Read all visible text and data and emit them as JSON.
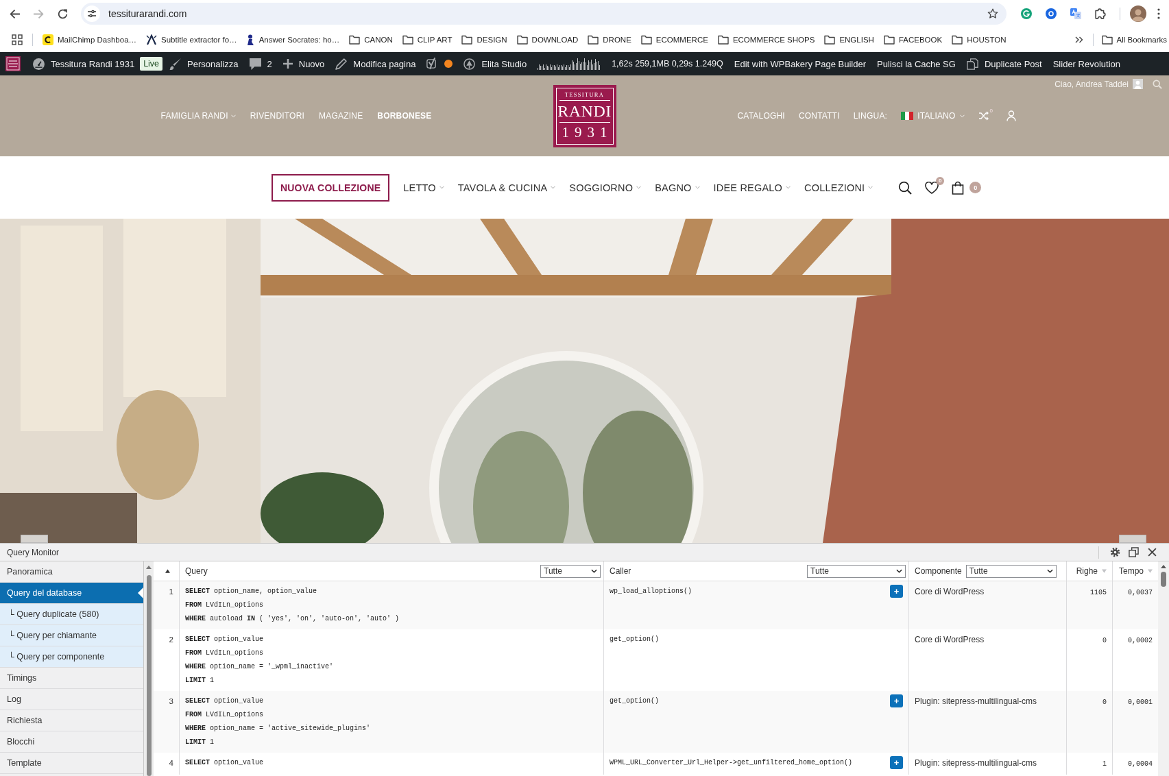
{
  "browser": {
    "url": "tessiturarandi.com",
    "bookmarks": [
      {
        "kind": "site",
        "label": "MailChimp Dashboa…"
      },
      {
        "kind": "site",
        "label": "Subtitle extractor fo…"
      },
      {
        "kind": "site",
        "label": "Answer Socrates: ho…"
      },
      {
        "kind": "folder",
        "label": "CANON"
      },
      {
        "kind": "folder",
        "label": "CLIP ART"
      },
      {
        "kind": "folder",
        "label": "DESIGN"
      },
      {
        "kind": "folder",
        "label": "DOWNLOAD"
      },
      {
        "kind": "folder",
        "label": "DRONE"
      },
      {
        "kind": "folder",
        "label": "ECOMMERCE"
      },
      {
        "kind": "folder",
        "label": "ECOMMERCE SHOPS"
      },
      {
        "kind": "folder",
        "label": "ENGLISH"
      },
      {
        "kind": "folder",
        "label": "FACEBOOK"
      },
      {
        "kind": "folder",
        "label": "HOUSTON"
      }
    ],
    "all_bookmarks": "All Bookmarks"
  },
  "admin_bar": {
    "site_name": "Tessitura Randi 1931",
    "badge": "Live",
    "items": [
      {
        "kind": "customize",
        "label": "Personalizza"
      },
      {
        "kind": "comments",
        "label": "2"
      },
      {
        "kind": "new",
        "label": "Nuovo"
      },
      {
        "kind": "edit",
        "label": "Modifica pagina"
      },
      {
        "kind": "seo",
        "color": "#f4851f"
      },
      {
        "kind": "studio",
        "label": "Elita Studio"
      },
      {
        "kind": "metrics",
        "label": "1,62s 259,1MB 0,29s 1.249Q"
      },
      {
        "kind": "text",
        "label": "Edit with WPBakery Page Builder"
      },
      {
        "kind": "text",
        "label": "Pulisci la Cache SG"
      },
      {
        "kind": "duplicate",
        "label": "Duplicate Post"
      },
      {
        "kind": "text",
        "label": "Slider Revolution"
      }
    ]
  },
  "site_header": {
    "greeting": "Ciao, Andrea Taddei",
    "left_menu": [
      {
        "label": "FAMIGLIA RANDI",
        "dropdown": true,
        "selected": false
      },
      {
        "label": "RIVENDITORI",
        "dropdown": false,
        "selected": false
      },
      {
        "label": "MAGAZINE",
        "dropdown": false,
        "selected": false
      },
      {
        "label": "BORBONESE",
        "dropdown": false,
        "selected": true
      }
    ],
    "logo": {
      "top": "TESSITURA",
      "name": "RANDI",
      "year": "1931"
    },
    "right_menu": [
      {
        "label": "CATALOGHI"
      },
      {
        "label": "CONTATTI"
      }
    ],
    "language_label": "LINGUA:",
    "language": "ITALIANO",
    "compare_count": "0"
  },
  "nav": {
    "featured": "NUOVA COLLEZIONE",
    "items": [
      {
        "label": "LETTO",
        "dropdown": true
      },
      {
        "label": "TAVOLA & CUCINA",
        "dropdown": true
      },
      {
        "label": "SOGGIORNO",
        "dropdown": true
      },
      {
        "label": "BAGNO",
        "dropdown": true
      },
      {
        "label": "IDEE REGALO",
        "dropdown": true
      },
      {
        "label": "COLLEZIONI",
        "dropdown": true
      }
    ],
    "wishlist_count": "0",
    "cart_count": "0"
  },
  "query_monitor": {
    "title": "Query Monitor",
    "menu": [
      {
        "label": "Panoramica",
        "selected": false
      },
      {
        "label": "Query del database",
        "selected": true,
        "children": [
          {
            "label": "└ Query duplicate (580)",
            "selected": false
          },
          {
            "label": "└ Query per chiamante",
            "selected": false
          },
          {
            "label": "└ Query per componente",
            "selected": false
          }
        ]
      },
      {
        "label": "Timings",
        "selected": false
      },
      {
        "label": "Log",
        "selected": false
      },
      {
        "label": "Richiesta",
        "selected": false
      },
      {
        "label": "Blocchi",
        "selected": false
      },
      {
        "label": "Template",
        "selected": false
      }
    ],
    "table": {
      "columns": [
        {
          "kind": "index",
          "sorted": true
        },
        {
          "kind": "filter",
          "label": "Query",
          "filter": "Tutte"
        },
        {
          "kind": "filter",
          "label": "Caller",
          "filter": "Tutte"
        },
        {
          "kind": "filter",
          "label": "Componente",
          "filter": "Tutte"
        },
        {
          "kind": "sort",
          "label": "Righe",
          "sorted": false
        },
        {
          "kind": "sort",
          "label": "Tempo",
          "sorted": false
        }
      ],
      "rows": [
        {
          "number": "1",
          "sql": [
            "**SELECT** option_name, option_value",
            "**FROM** LVdILn_options",
            "**WHERE** autoload **IN** ( 'yes', 'on', 'auto-on', 'auto' )"
          ],
          "caller": "wp_load_alloptions()",
          "toggle": "+",
          "component": "Core di WordPress",
          "count": "1105",
          "time": "0,0037"
        },
        {
          "number": "2",
          "sql": [
            "**SELECT** option_value",
            "**FROM** LVdILn_options",
            "**WHERE** option_name = '_wpml_inactive'",
            "**LIMIT** 1"
          ],
          "caller": "get_option()",
          "component": "Core di WordPress",
          "count": "0",
          "time": "0,0002"
        },
        {
          "number": "3",
          "sql": [
            "**SELECT** option_value",
            "**FROM** LVdILn_options",
            "**WHERE** option_name = 'active_sitewide_plugins'",
            "**LIMIT** 1"
          ],
          "caller": "get_option()",
          "toggle": "+",
          "component": "Plugin: sitepress-multilingual-cms",
          "count": "0",
          "time": "0,0001"
        },
        {
          "number": "4",
          "sql": [
            "**SELECT** option_value"
          ],
          "caller": "WPML_URL_Converter_Url_Helper->get_unfiltered_home_option()",
          "toggle": "+",
          "component": "Plugin: sitepress-multilingual-cms",
          "count": "1",
          "time": "0,0004"
        }
      ]
    }
  }
}
